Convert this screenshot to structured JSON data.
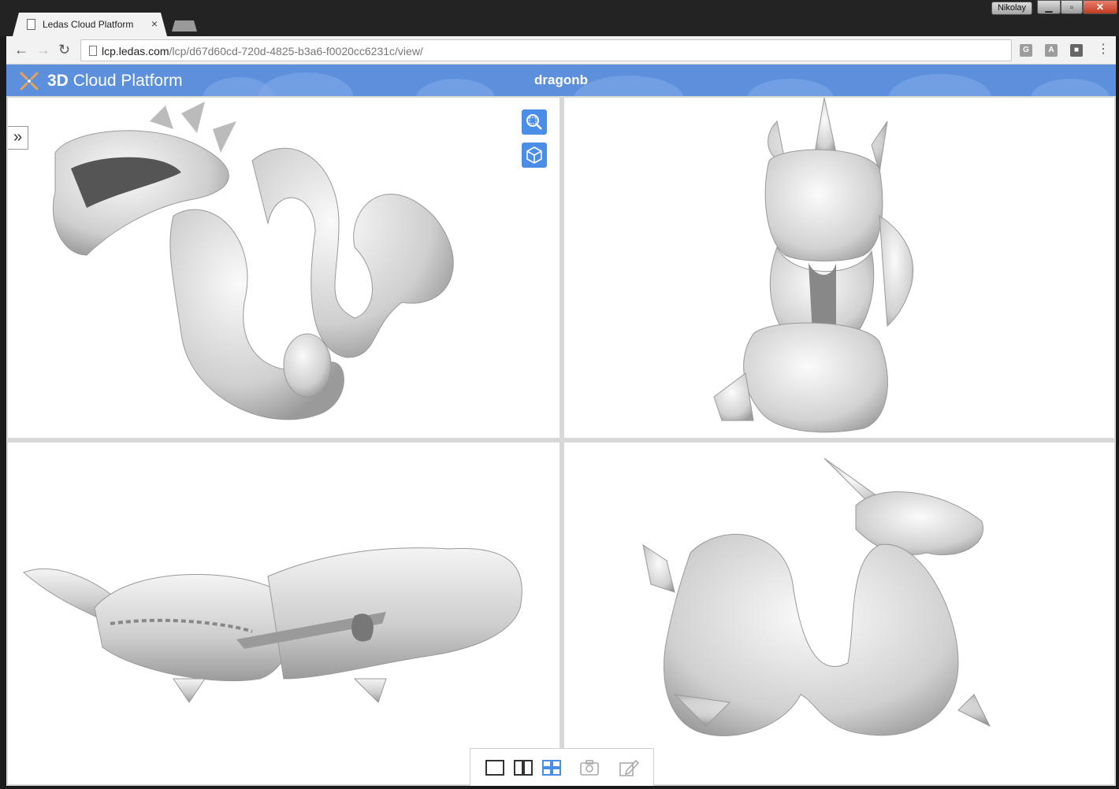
{
  "browser": {
    "tab_title": "Ledas Cloud Platform",
    "tab_close": "×",
    "url_host": "lcp.ledas.com",
    "url_path": "/lcp/d67d60cd-720d-4825-b3a6-f0020cc6231c/view/",
    "user_name": "Nikolay",
    "extensions": [
      "G",
      "A",
      "■"
    ]
  },
  "app": {
    "brand_bold": "3D",
    "brand_rest": " Cloud Platform",
    "document_title": "dragonb",
    "accent_color": "#5c8fdc",
    "tool_color": "#4a8ee8"
  },
  "viewer": {
    "panel_toggle_glyph": "»",
    "viewports": [
      {
        "view": "perspective-left"
      },
      {
        "view": "front"
      },
      {
        "view": "top"
      },
      {
        "view": "side"
      }
    ],
    "tools": [
      "zoom-fit-icon",
      "cube-view-icon"
    ],
    "layout_buttons": [
      "single-view-icon",
      "two-views-icon",
      "four-views-icon",
      "snapshot-icon",
      "markup-icon"
    ],
    "active_layout": "four-views-icon"
  }
}
